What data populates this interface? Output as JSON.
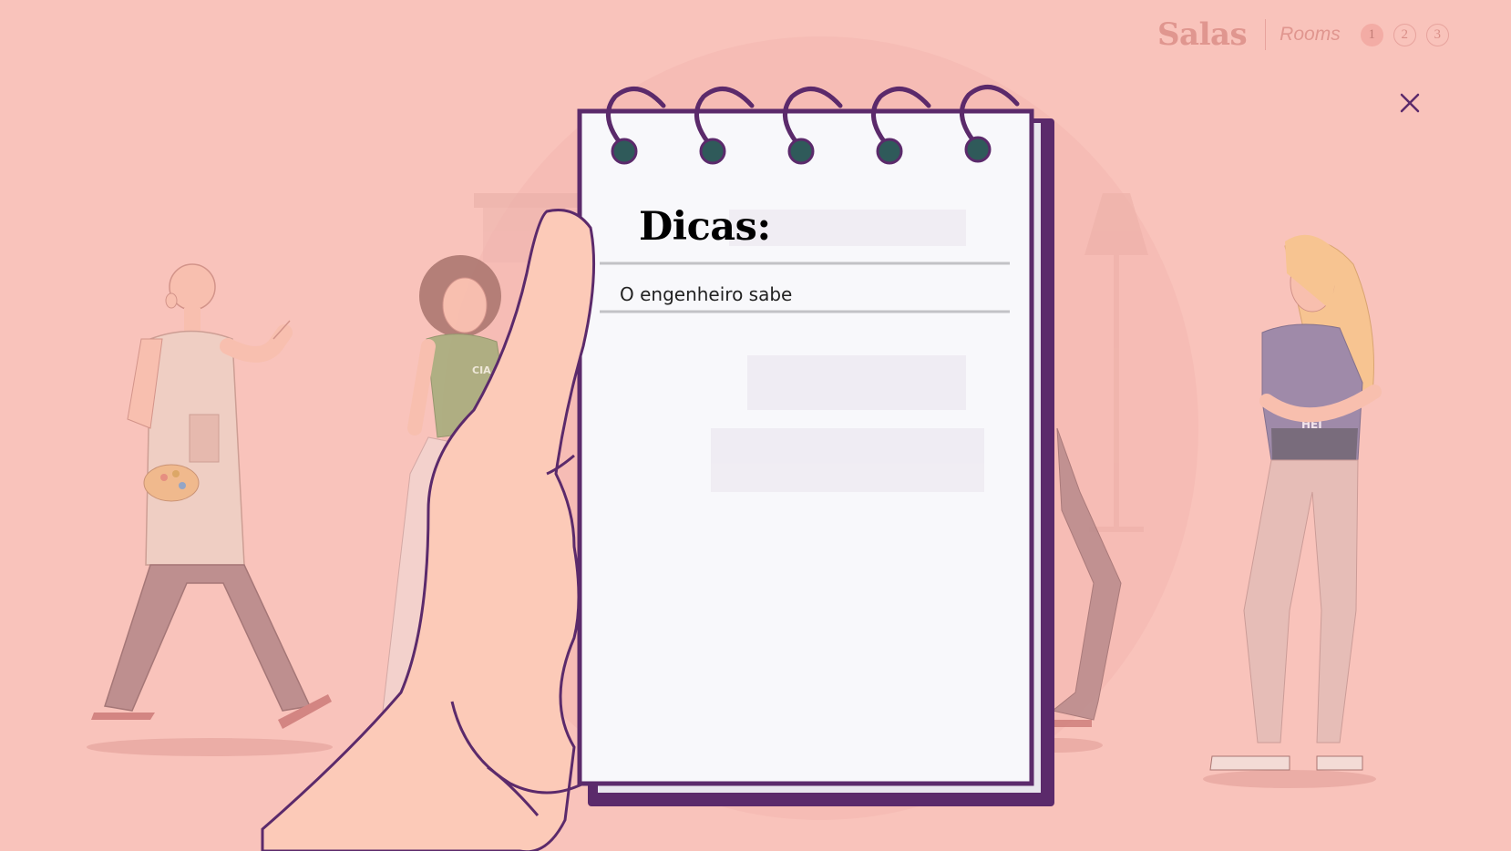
{
  "header": {
    "title": "Salas",
    "subtitle": "Rooms",
    "rooms": [
      "1",
      "2",
      "3"
    ]
  },
  "notepad": {
    "title": "Dicas:",
    "tips": [
      "O engenheiro sabe"
    ]
  },
  "icons": {
    "close": "close-icon"
  },
  "colors": {
    "background": "#f9c3bb",
    "accent": "#5b2a6b",
    "spiral_hole": "#2f5a5a",
    "paper": "#f8f8fb"
  }
}
